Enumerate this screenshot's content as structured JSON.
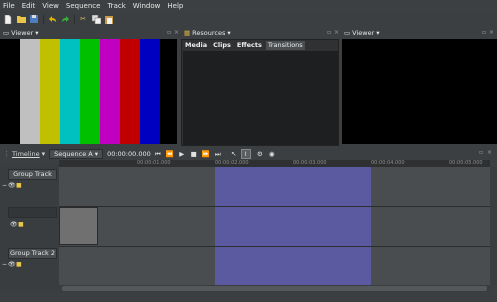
{
  "menu": [
    "File",
    "Edit",
    "View",
    "Sequence",
    "Track",
    "Window",
    "Help"
  ],
  "toolbar_icons": [
    "new-file-icon",
    "open-folder-icon",
    "save-icon",
    "undo-icon",
    "redo-icon",
    "cut-icon",
    "copy-icon",
    "paste-icon"
  ],
  "panels": {
    "viewer_left": {
      "title": "Viewer",
      "close": "×",
      "float": "▫"
    },
    "resources": {
      "title": "Resources",
      "tabs": [
        "Media",
        "Clips",
        "Effects",
        "Transitions"
      ],
      "active_tab": "Transitions"
    },
    "viewer_right": {
      "title": "Viewer"
    }
  },
  "color_bars": [
    "#c0c0c0",
    "#c0c000",
    "#00c0c0",
    "#00c000",
    "#c000c0",
    "#c00000",
    "#0000c0"
  ],
  "timeline": {
    "title": "Timeline",
    "sequence": "Sequence A",
    "timecode": "00:00:00.000",
    "transport": [
      "⏮",
      "⏪",
      "▶",
      "■",
      "⏩",
      "⏭"
    ],
    "ruler_labels": [
      "00:00:01.000",
      "00:00:02.000",
      "00:00:03.000",
      "00:00:04.000",
      "00:00:05.000"
    ],
    "tracks": [
      {
        "label": "Group Track"
      },
      {
        "label": ""
      },
      {
        "label": "Group Track 2"
      }
    ]
  },
  "colors": {
    "selection": "#5b5aa0",
    "clip": "#707070",
    "track_bg": "#4a4d50"
  }
}
